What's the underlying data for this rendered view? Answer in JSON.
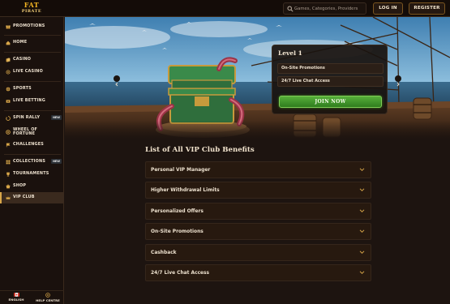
{
  "brand": {
    "line1": "FAT",
    "line2": "PIRATE"
  },
  "header": {
    "search": {
      "placeholder": "Games, Categories, Providers"
    },
    "login_label": "LOG IN",
    "register_label": "REGISTER"
  },
  "sidebar": {
    "items": [
      {
        "label": "PROMOTIONS",
        "icon": "gift-icon"
      },
      {
        "label": "HOME",
        "icon": "home-icon"
      },
      {
        "label": "CASINO",
        "icon": "cards-icon"
      },
      {
        "label": "LIVE CASINO",
        "icon": "live-icon"
      },
      {
        "label": "SPORTS",
        "icon": "ball-icon"
      },
      {
        "label": "LIVE BETTING",
        "icon": "live-bet-icon"
      },
      {
        "label": "SPIN RALLY",
        "icon": "spin-icon",
        "badge": "NEW"
      },
      {
        "label": "WHEEL OF\nFORTUNE",
        "icon": "wheel-icon"
      },
      {
        "label": "CHALLENGES",
        "icon": "challenge-icon"
      },
      {
        "label": "COLLECTIONS",
        "icon": "collection-icon",
        "badge": "NEW"
      },
      {
        "label": "TOURNAMENTS",
        "icon": "trophy-icon"
      },
      {
        "label": "SHOP",
        "icon": "shop-icon"
      },
      {
        "label": "VIP CLUB",
        "icon": "crown-icon",
        "active": true
      }
    ],
    "footer": {
      "language_label": "ENGLISH",
      "help_label": "HELP CENTRE"
    }
  },
  "vip_card": {
    "level": "Level 1",
    "perks": [
      "On-Site Promotions",
      "24/7 Live Chat Access"
    ],
    "join_label": "JOIN NOW"
  },
  "benefits": {
    "title": "List of All VIP Club Benefits",
    "items": [
      "Personal VIP Manager",
      "Higher Withdrawal Limits",
      "Personalized Offers",
      "On-Site Promotions",
      "Cashback",
      "24/7 Live Chat Access"
    ]
  },
  "colors": {
    "accent_gold": "#d8a649",
    "join_green": "#3f9a2a",
    "background": "#1d1410"
  }
}
